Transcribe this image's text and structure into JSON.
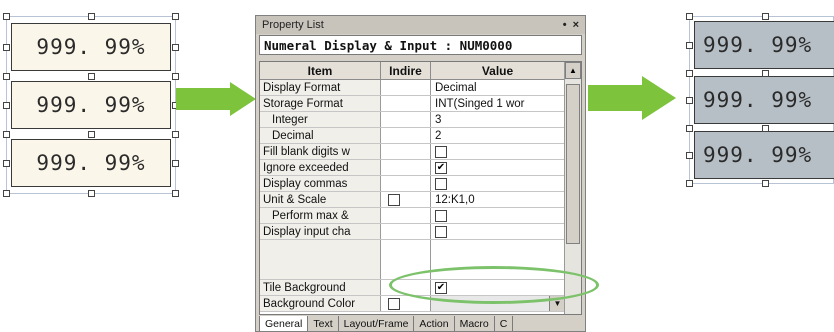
{
  "displays": {
    "left": [
      "999. 99%",
      "999. 99%",
      "999. 99%"
    ],
    "right": [
      "999. 99%",
      "999. 99%",
      "999. 99%"
    ]
  },
  "window": {
    "title": "Property List",
    "pin": "•",
    "close": "×",
    "object_name": "Numeral Display & Input : NUM0000"
  },
  "columns": {
    "item": "Item",
    "indirect": "Indire",
    "value": "Value"
  },
  "scroll_up": "▲",
  "dropdown": "▼",
  "rows": [
    {
      "item": "Display Format",
      "value": "Decimal"
    },
    {
      "item": "Storage Format",
      "value": "INT(Singed 1 wor"
    },
    {
      "item": "Integer",
      "value": "3"
    },
    {
      "item": "Decimal",
      "value": "2"
    },
    {
      "item": "Fill blank digits w",
      "value": ""
    },
    {
      "item": "Ignore exceeded",
      "value": "",
      "check": "✔"
    },
    {
      "item": "Display commas",
      "value": ""
    },
    {
      "item": "Unit & Scale",
      "value": "12:K1,0"
    },
    {
      "item": "Perform max &",
      "value": ""
    },
    {
      "item": "Display input cha",
      "value": ""
    },
    {
      "item": "Tile Background",
      "value": "",
      "check": "✔"
    },
    {
      "item": "Background Color",
      "value": ""
    }
  ],
  "tabs": [
    "General",
    "Text",
    "Layout/Frame",
    "Action",
    "Macro",
    "C"
  ],
  "colors": {
    "arrow": "#7dc43c",
    "highlight": "#7cc26a",
    "tile_bg": "#b6bfc6",
    "plain_bg": "#fbf6ea"
  }
}
